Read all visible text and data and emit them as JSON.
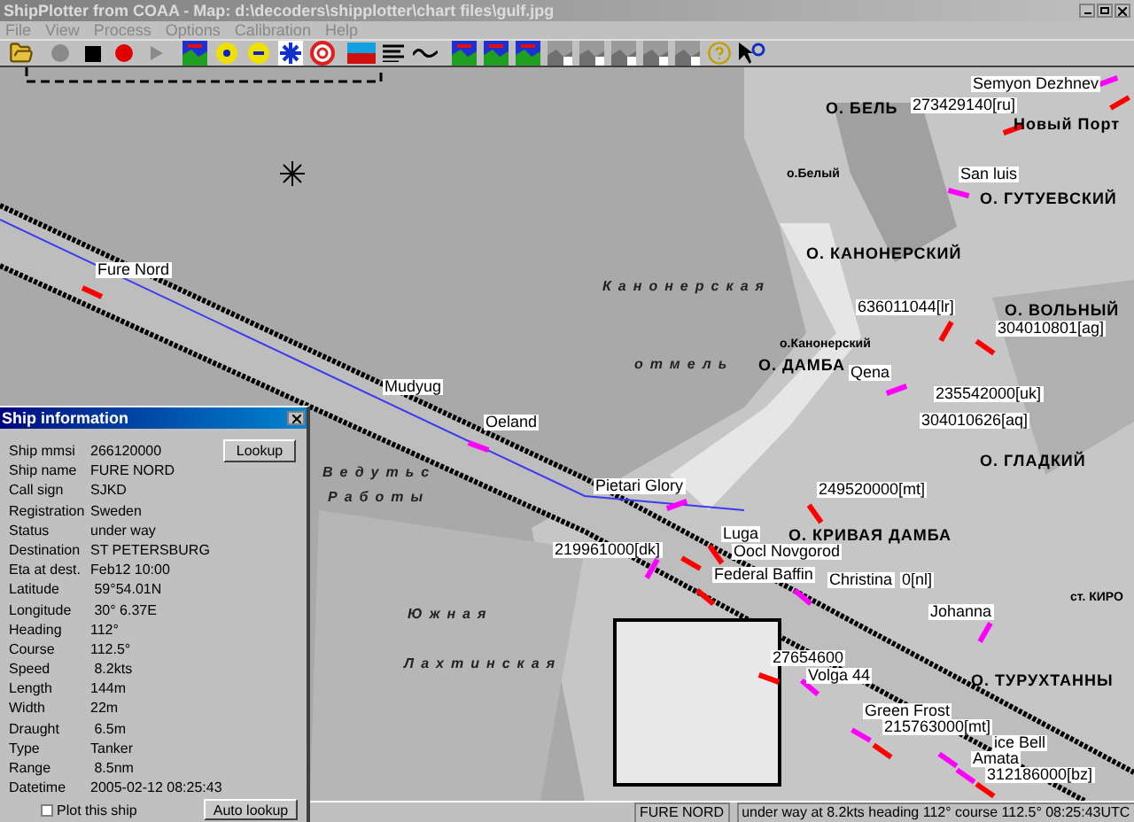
{
  "window": {
    "title": "ShipPlotter from COAA - Map: d:\\decoders\\shipplotter\\chart files\\gulf.jpg"
  },
  "menu": [
    "File",
    "View",
    "Process",
    "Options",
    "Calibration",
    "Help"
  ],
  "map_labels": [
    {
      "kind": "ship",
      "text": "Semyon Dezhnev"
    },
    {
      "kind": "place",
      "text": "О. БЕЛЬ"
    },
    {
      "kind": "ship",
      "text": "273429140[ru]"
    },
    {
      "kind": "place",
      "text": "Новый Порт"
    },
    {
      "kind": "small",
      "text": "о.Белый"
    },
    {
      "kind": "ship",
      "text": "San luis"
    },
    {
      "kind": "place",
      "text": "О. ГУТУЕВСКИЙ"
    },
    {
      "kind": "place",
      "text": "О. КАНОНЕРСКИЙ"
    },
    {
      "kind": "ship",
      "text": "Fure Nord"
    },
    {
      "kind": "water",
      "text": "Канонерская"
    },
    {
      "kind": "ship",
      "text": "636011044[lr]"
    },
    {
      "kind": "place",
      "text": "О. ВОЛЬНЫЙ"
    },
    {
      "kind": "ship",
      "text": "304010801[ag]"
    },
    {
      "kind": "small",
      "text": "о.Канонерский"
    },
    {
      "kind": "water",
      "text": "отмель"
    },
    {
      "kind": "place",
      "text": "О. ДАМБА"
    },
    {
      "kind": "ship",
      "text": "Qena"
    },
    {
      "kind": "ship",
      "text": "Mudyug"
    },
    {
      "kind": "ship",
      "text": "235542000[uk]"
    },
    {
      "kind": "ship",
      "text": "Oeland"
    },
    {
      "kind": "ship",
      "text": "304010626[aq]"
    },
    {
      "kind": "water",
      "text": "Ведутьс"
    },
    {
      "kind": "place",
      "text": "О. ГЛАДКИЙ"
    },
    {
      "kind": "water",
      "text": "Работы"
    },
    {
      "kind": "ship",
      "text": "Pietari Glory"
    },
    {
      "kind": "ship",
      "text": "249520000[mt]"
    },
    {
      "kind": "ship",
      "text": "Luga"
    },
    {
      "kind": "place",
      "text": "О. КРИВАЯ ДАМБА"
    },
    {
      "kind": "ship",
      "text": "219961000[dk]"
    },
    {
      "kind": "ship",
      "text": "Oocl Novgorod"
    },
    {
      "kind": "ship",
      "text": "Federal Baffin"
    },
    {
      "kind": "ship",
      "text": "Christina"
    },
    {
      "kind": "ship",
      "text": "0[nl]"
    },
    {
      "kind": "small",
      "text": "ст. КИРО"
    },
    {
      "kind": "ship",
      "text": "Johanna"
    },
    {
      "kind": "water",
      "text": "Южная"
    },
    {
      "kind": "ship",
      "text": "27654600"
    },
    {
      "kind": "water",
      "text": "Лахтинская"
    },
    {
      "kind": "ship",
      "text": "Volga 44"
    },
    {
      "kind": "place",
      "text": "О. ТУРУХТАННЫ"
    },
    {
      "kind": "ship",
      "text": "Green Frost"
    },
    {
      "kind": "ship",
      "text": "215763000[mt]"
    },
    {
      "kind": "ship",
      "text": "ice Bell"
    },
    {
      "kind": "ship",
      "text": "Amata"
    },
    {
      "kind": "ship",
      "text": "312186000[bz]"
    }
  ],
  "ship_markers": [
    {
      "color": "#ff00ff"
    },
    {
      "color": "#ff0000"
    },
    {
      "color": "#ff0000"
    },
    {
      "color": "#ff00ff"
    },
    {
      "color": "#ff0000"
    },
    {
      "color": "#ff0000"
    },
    {
      "color": "#ff00ff"
    },
    {
      "color": "#ff00ff"
    },
    {
      "color": "#ff0000"
    },
    {
      "color": "#ff0000"
    },
    {
      "color": "#ff00ff"
    },
    {
      "color": "#ff0000"
    },
    {
      "color": "#ff0000"
    },
    {
      "color": "#ff00ff"
    },
    {
      "color": "#ff0000"
    },
    {
      "color": "#ff00ff"
    },
    {
      "color": "#ff00ff"
    },
    {
      "color": "#ff0000"
    },
    {
      "color": "#ff00ff"
    },
    {
      "color": "#ff00ff"
    },
    {
      "color": "#ff0000"
    },
    {
      "color": "#ff00ff"
    },
    {
      "color": "#ff00ff"
    },
    {
      "color": "#ff0000"
    }
  ],
  "ship_info": {
    "title": "Ship information",
    "fields": [
      {
        "label": "Ship mmsi",
        "value": "266120000"
      },
      {
        "label": "Ship name",
        "value": "FURE NORD"
      },
      {
        "label": "Call sign",
        "value": "SJKD"
      },
      {
        "label": "Registration",
        "value": "Sweden"
      },
      {
        "label": "Status",
        "value": "under way"
      },
      {
        "label": "Destination",
        "value": "ST PETERSBURG"
      },
      {
        "label": "Eta at dest.",
        "value": "Feb12 10:00"
      },
      {
        "label": "Latitude",
        "value": " 59°54.01N"
      },
      {
        "label": "Longitude",
        "value": " 30° 6.37E"
      },
      {
        "label": "Heading",
        "value": "112°"
      },
      {
        "label": "Course",
        "value": "112.5°"
      },
      {
        "label": "Speed",
        "value": " 8.2kts"
      },
      {
        "label": "Length",
        "value": "144m"
      },
      {
        "label": "Width",
        "value": "22m"
      },
      {
        "label": "Draught",
        "value": " 6.5m"
      },
      {
        "label": "Type",
        "value": "Tanker"
      },
      {
        "label": "Range",
        "value": " 8.5nm"
      },
      {
        "label": "Datetime",
        "value": "2005-02-12 08:25:43"
      }
    ],
    "lookup_button": "Lookup",
    "plot_checkbox": {
      "label": "Plot this ship",
      "checked": false
    },
    "auto_lookup_button": "Auto lookup"
  },
  "status_bar": [
    "FURE NORD",
    "under way  at  8.2kts heading 112° course 112.5° 08:25:43UTC"
  ]
}
